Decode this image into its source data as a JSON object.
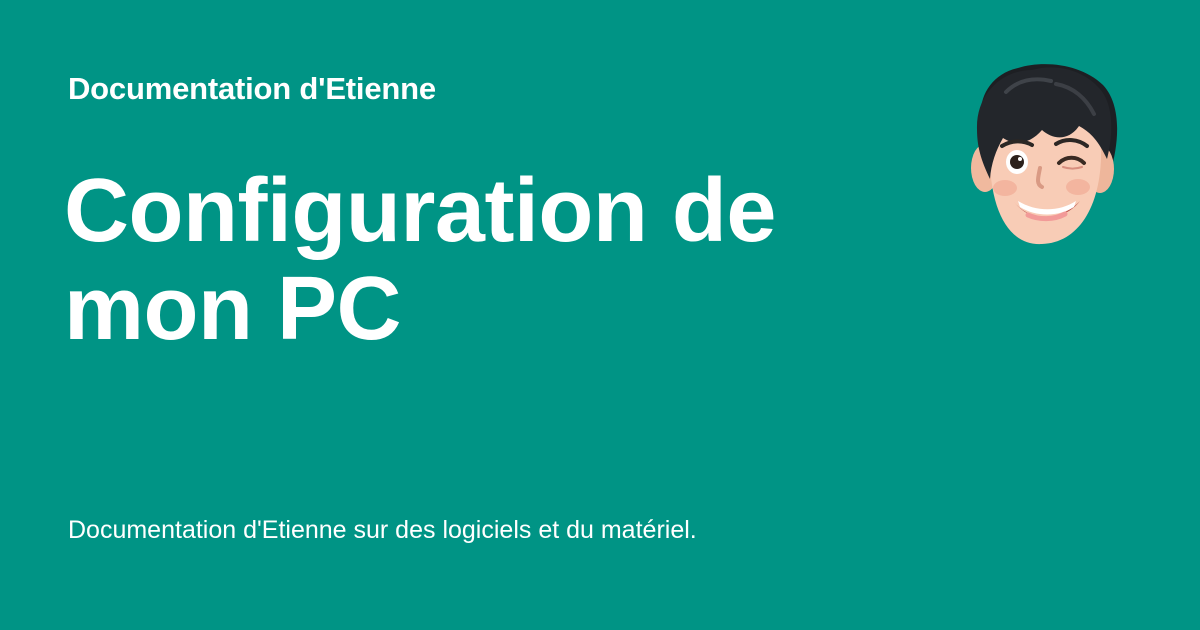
{
  "card": {
    "site_name": "Documentation d'Etienne",
    "title": "Configuration de mon PC",
    "description": "Documentation d'Etienne sur des logiciels et du matériel.",
    "background_color": "#009485",
    "text_color": "#FFFFFF",
    "avatar_icon": "winking-memoji-avatar"
  }
}
